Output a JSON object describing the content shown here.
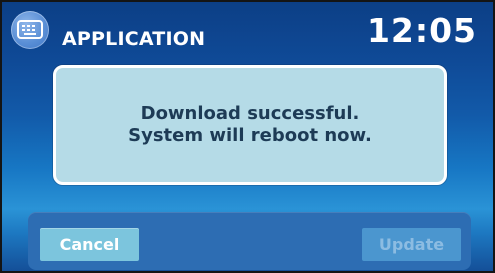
{
  "header": {
    "title": "APPLICATION",
    "clock": "12:05",
    "icon": "keyboard-icon"
  },
  "dialog": {
    "line1": "Download successful.",
    "line2": "System will reboot now."
  },
  "buttons": {
    "cancel_label": "Cancel",
    "update_label": "Update",
    "update_enabled": false
  },
  "colors": {
    "background": "#125aa9",
    "dialog_fill": "#b5dbe7",
    "dialog_text": "#1d3b56",
    "cancel_button": "#7cc5dd",
    "update_button_disabled": "#4b96cf"
  }
}
